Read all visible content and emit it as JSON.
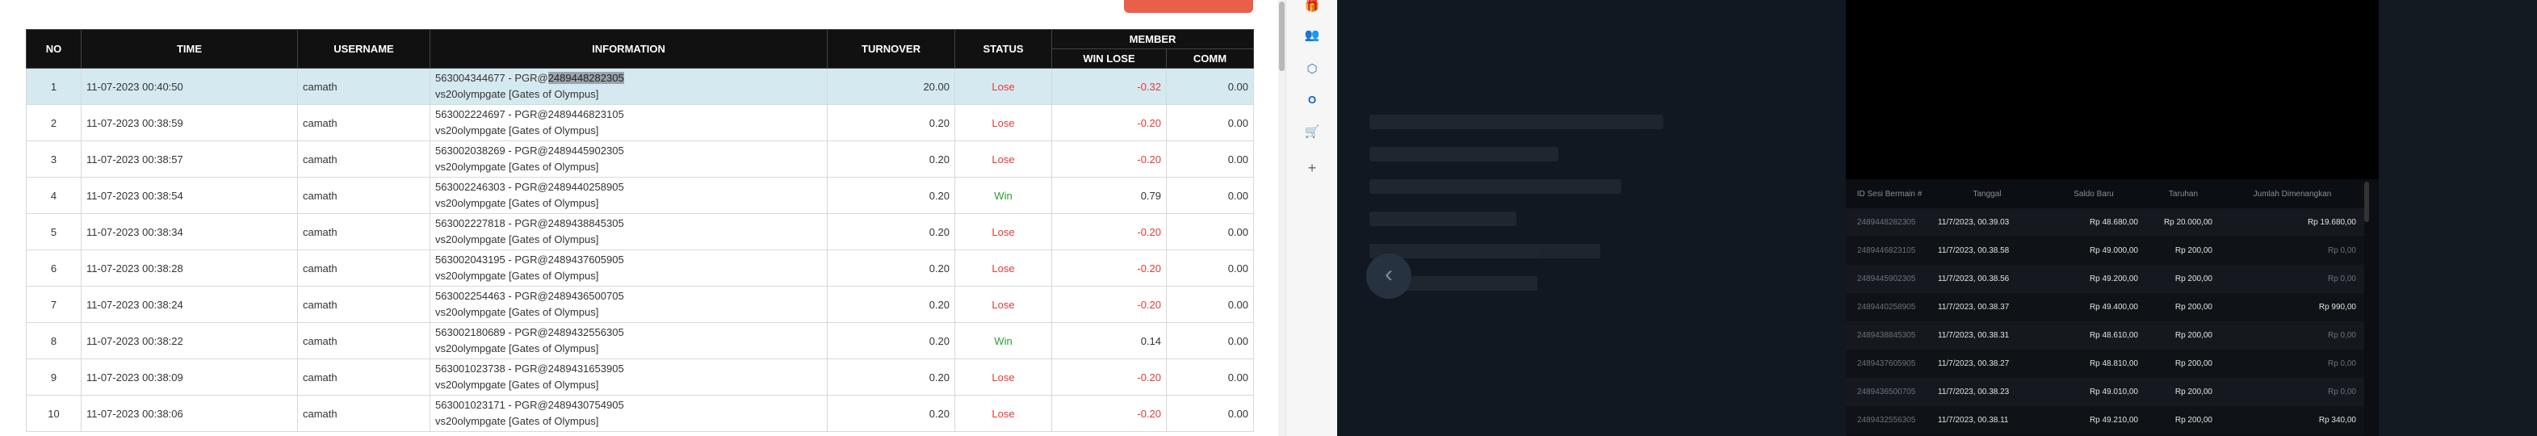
{
  "left": {
    "columns": {
      "no": "NO",
      "time": "TIME",
      "username": "USERNAME",
      "information": "INFORMATION",
      "turnover": "TURNOVER",
      "status": "STATUS",
      "member": "MEMBER",
      "win_lose": "WIN LOSE",
      "comm": "COMM"
    },
    "rows": [
      {
        "no": "1",
        "time": "11-07-2023 00:40:50",
        "username": "camath",
        "info_a": "563004344677 - PGR@",
        "info_hl": "2489448282305",
        "info_b": "vs20olympgate [Gates of Olympus]",
        "turnover": "20.00",
        "status": "Lose",
        "win_lose": "-0.32",
        "comm": "0.00"
      },
      {
        "no": "2",
        "time": "11-07-2023 00:38:59",
        "username": "camath",
        "info_a": "563002224697 - PGR@2489446823105",
        "info_hl": "",
        "info_b": "vs20olympgate [Gates of Olympus]",
        "turnover": "0.20",
        "status": "Lose",
        "win_lose": "-0.20",
        "comm": "0.00"
      },
      {
        "no": "3",
        "time": "11-07-2023 00:38:57",
        "username": "camath",
        "info_a": "563002038269 - PGR@2489445902305",
        "info_hl": "",
        "info_b": "vs20olympgate [Gates of Olympus]",
        "turnover": "0.20",
        "status": "Lose",
        "win_lose": "-0.20",
        "comm": "0.00"
      },
      {
        "no": "4",
        "time": "11-07-2023 00:38:54",
        "username": "camath",
        "info_a": "563002246303 - PGR@2489440258905",
        "info_hl": "",
        "info_b": "vs20olympgate [Gates of Olympus]",
        "turnover": "0.20",
        "status": "Win",
        "win_lose": "0.79",
        "comm": "0.00"
      },
      {
        "no": "5",
        "time": "11-07-2023 00:38:34",
        "username": "camath",
        "info_a": "563002227818 - PGR@2489438845305",
        "info_hl": "",
        "info_b": "vs20olympgate [Gates of Olympus]",
        "turnover": "0.20",
        "status": "Lose",
        "win_lose": "-0.20",
        "comm": "0.00"
      },
      {
        "no": "6",
        "time": "11-07-2023 00:38:28",
        "username": "camath",
        "info_a": "563002043195 - PGR@2489437605905",
        "info_hl": "",
        "info_b": "vs20olympgate [Gates of Olympus]",
        "turnover": "0.20",
        "status": "Lose",
        "win_lose": "-0.20",
        "comm": "0.00"
      },
      {
        "no": "7",
        "time": "11-07-2023 00:38:24",
        "username": "camath",
        "info_a": "563002254463 - PGR@2489436500705",
        "info_hl": "",
        "info_b": "vs20olympgate [Gates of Olympus]",
        "turnover": "0.20",
        "status": "Lose",
        "win_lose": "-0.20",
        "comm": "0.00"
      },
      {
        "no": "8",
        "time": "11-07-2023 00:38:22",
        "username": "camath",
        "info_a": "563002180689 - PGR@2489432556305",
        "info_hl": "",
        "info_b": "vs20olympgate [Gates of Olympus]",
        "turnover": "0.20",
        "status": "Win",
        "win_lose": "0.14",
        "comm": "0.00"
      },
      {
        "no": "9",
        "time": "11-07-2023 00:38:09",
        "username": "camath",
        "info_a": "563001023738 - PGR@2489431653905",
        "info_hl": "",
        "info_b": "vs20olympgate [Gates of Olympus]",
        "turnover": "0.20",
        "status": "Lose",
        "win_lose": "-0.20",
        "comm": "0.00"
      },
      {
        "no": "10",
        "time": "11-07-2023 00:38:06",
        "username": "camath",
        "info_a": "563001023171 - PGR@2489430754905",
        "info_hl": "",
        "info_b": "vs20olympgate [Gates of Olympus]",
        "turnover": "0.20",
        "status": "Lose",
        "win_lose": "-0.20",
        "comm": "0.00"
      }
    ]
  },
  "strip_icons": [
    "gift-icon",
    "people-icon",
    "hexagon-icon",
    "outlook-icon",
    "cart-icon",
    "plus-icon"
  ],
  "colors": {
    "lose": "#e53935",
    "win": "#2e9b33",
    "accent": "#e8604a",
    "dark_bg": "#111821"
  },
  "history": {
    "columns": {
      "id": "ID Sesi Bermain #",
      "date": "Tanggal",
      "balance": "Saldo Baru",
      "bet": "Taruhan",
      "win": "Jumlah Dimenangkan"
    },
    "rows": [
      {
        "id": "2489448282305",
        "date": "11/7/2023, 00.39.03",
        "balance": "Rp 48.680,00",
        "bet": "Rp 20.000,00",
        "win": "Rp 19.680,00"
      },
      {
        "id": "2489446823105",
        "date": "11/7/2023, 00.38.58",
        "balance": "Rp 49.000,00",
        "bet": "Rp 200,00",
        "win": "Rp 0,00"
      },
      {
        "id": "2489445902305",
        "date": "11/7/2023, 00.38.56",
        "balance": "Rp 49.200,00",
        "bet": "Rp 200,00",
        "win": "Rp 0,00"
      },
      {
        "id": "2489440258905",
        "date": "11/7/2023, 00.38.37",
        "balance": "Rp 49.400,00",
        "bet": "Rp 200,00",
        "win": "Rp 990,00"
      },
      {
        "id": "2489438845305",
        "date": "11/7/2023, 00.38.31",
        "balance": "Rp 48.610,00",
        "bet": "Rp 200,00",
        "win": "Rp 0,00"
      },
      {
        "id": "2489437605905",
        "date": "11/7/2023, 00.38.27",
        "balance": "Rp 48.810,00",
        "bet": "Rp 200,00",
        "win": "Rp 0,00"
      },
      {
        "id": "2489436500705",
        "date": "11/7/2023, 00.38.23",
        "balance": "Rp 49.010,00",
        "bet": "Rp 200,00",
        "win": "Rp 0,00"
      },
      {
        "id": "2489432556305",
        "date": "11/7/2023, 00.38.11",
        "balance": "Rp 49.210,00",
        "bet": "Rp 200,00",
        "win": "Rp 340,00"
      }
    ]
  }
}
